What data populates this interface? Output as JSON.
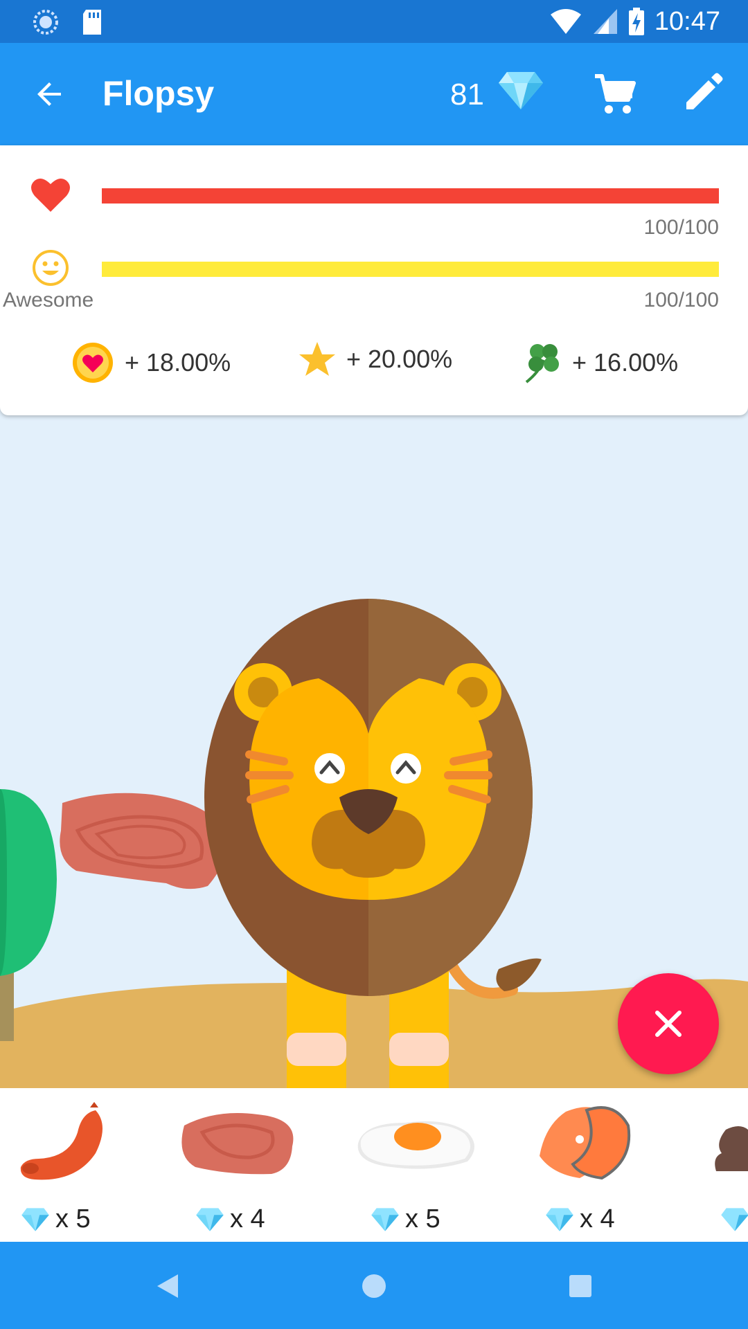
{
  "status_bar": {
    "time": "10:47"
  },
  "app_bar": {
    "title": "Flopsy",
    "gems": "81"
  },
  "stats": {
    "health": {
      "value": "100/100",
      "level": 1.0,
      "color": "#f44336"
    },
    "mood": {
      "value": "100/100",
      "label": "Awesome",
      "level": 1.0,
      "color": "#ffeb3b"
    },
    "bonuses": [
      {
        "icon": "heart-coin-icon",
        "text": "+ 18.00%"
      },
      {
        "icon": "star-icon",
        "text": "+ 20.00%"
      },
      {
        "icon": "clover-icon",
        "text": "+ 16.00%"
      }
    ]
  },
  "foods": [
    {
      "name": "sausage",
      "price": "x 5"
    },
    {
      "name": "steak",
      "price": "x 4"
    },
    {
      "name": "fried-egg",
      "price": "x 5"
    },
    {
      "name": "salmon",
      "price": "x 4"
    },
    {
      "name": "chocolate",
      "price": ""
    }
  ],
  "colors": {
    "status_bar": "#1976d2",
    "app_bar": "#2196f3",
    "fab": "#ff1a50"
  }
}
